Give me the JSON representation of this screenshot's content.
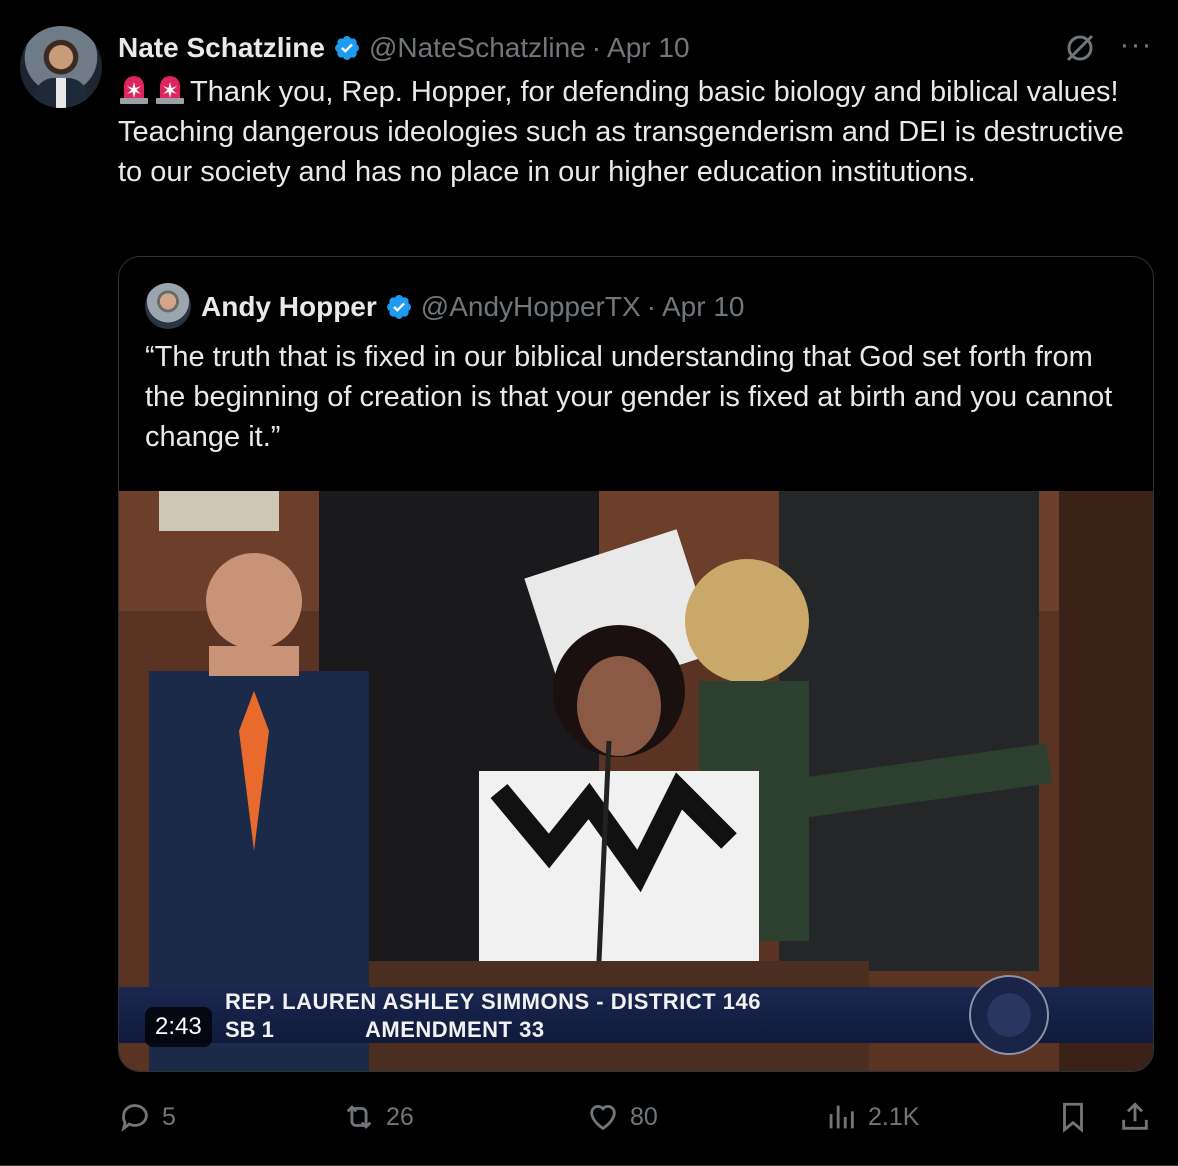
{
  "tweet": {
    "author_name": "Nate Schatzline",
    "author_handle": "@NateSchatzline",
    "separator": "·",
    "date": "Apr 10",
    "emoji": [
      "🚨",
      "🚨"
    ],
    "text": "Thank you, Rep. Hopper, for defending basic biology and biblical values! Teaching dangerous ideologies such as transgenderism and DEI is destructive to our society and has no place in our higher education institutions.",
    "icons": [
      "verified-badge-icon",
      "grok-icon",
      "more-icon"
    ],
    "colors": {
      "verified": "#1d9bf0",
      "siren": "#e0245e",
      "muted": "#71767b"
    }
  },
  "quote": {
    "author_name": "Andy Hopper",
    "author_handle": "@AndyHopperTX",
    "separator": "·",
    "date": "Apr 10",
    "text": "“The truth that is fixed in our biblical understanding that God set forth from the beginning of creation is that your gender is fixed at birth and you cannot change it.”",
    "video": {
      "duration": "2:43",
      "chyron_line1": "REP. LAUREN ASHLEY SIMMONS - DISTRICT 146",
      "chyron_line2_left": "SB 1",
      "chyron_line2_right": "AMENDMENT  33"
    }
  },
  "actions": {
    "replies": "5",
    "reposts": "26",
    "likes": "80",
    "views": "2.1K"
  }
}
